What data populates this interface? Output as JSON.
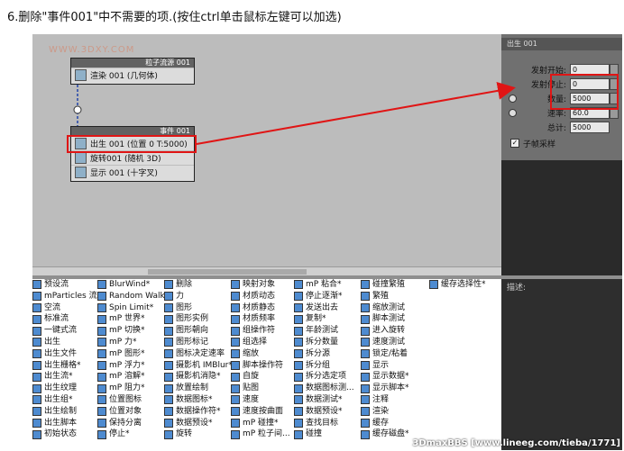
{
  "caption": "6.删除\"事件001\"中不需要的项.(按住ctrl单击鼠标左键可以加选)",
  "watermark": "WWW.3DXY.COM",
  "node_source": {
    "header": "粒子流源 001",
    "row": "渲染 001 (几何体)"
  },
  "node_event": {
    "header": "事件 001",
    "rows": [
      "出生 001 (位置 0 T:5000)",
      "旋转001 (随机 3D)",
      "显示 001 (十字叉)"
    ]
  },
  "panel": {
    "tab": "出生 001",
    "rows": [
      {
        "label": "发射开始:",
        "value": "0"
      },
      {
        "label": "发射停止:",
        "value": "0"
      },
      {
        "label": "数量:",
        "value": "5000"
      },
      {
        "label": "速率:",
        "value": "60.0"
      },
      {
        "label": "总计:",
        "value": "5000"
      }
    ],
    "checkbox": "子帧采样"
  },
  "description_label": "描述:",
  "operators": [
    [
      "预设流",
      "mParticles 流*",
      "空流",
      "标准流",
      "一键式流",
      "出生",
      "出生文件",
      "出生栅格*",
      "出生流*",
      "出生纹理",
      "出生组*",
      "出生绘制",
      "出生脚本",
      "初始状态"
    ],
    [
      "BlurWind*",
      "Random Walk*",
      "Spin Limit*",
      "mP 世界*",
      "mP 切换*",
      "mP 力*",
      "mP 图形*",
      "mP 浮力*",
      "mP 溶解*",
      "mP 阻力*",
      "位置图标",
      "位置对象",
      "保持分离",
      "停止*"
    ],
    [
      "删除",
      "力",
      "图形",
      "图形实例",
      "图形朝向",
      "图形标记",
      "图标决定速率",
      "摄影机 IMBlur*",
      "摄影机消隐*",
      "放置绘制",
      "数据图标*",
      "数据操作符*",
      "数据预设*",
      "旋转"
    ],
    [
      "映射对象",
      "材质动态",
      "材质静态",
      "材质频率",
      "组操作符",
      "组选择",
      "缩放",
      "脚本操作符",
      "自旋",
      "贴图",
      "速度",
      "速度按曲面",
      "mP 碰撞*",
      "mP 粒子间..."
    ],
    [
      "mP 粘合*",
      "停止逐渐*",
      "发送出去",
      "复制*",
      "年龄测试",
      "拆分数量",
      "拆分源",
      "拆分组",
      "拆分选定项",
      "数据图标测...",
      "数据测试*",
      "数据预设*",
      "查找目标",
      "碰撞"
    ],
    [
      "碰撞繁殖",
      "繁殖",
      "缩放测试",
      "脚本测试",
      "进入旋转",
      "速度测试",
      "锁定/粘着",
      "显示",
      "显示数据*",
      "显示脚本*",
      "注释",
      "渲染",
      "缓存",
      "缓存磁盘*"
    ],
    [
      "缓存选择性*"
    ]
  ],
  "footer": "3DmaxBBS [www.lineeg.com/tieba/1771]"
}
